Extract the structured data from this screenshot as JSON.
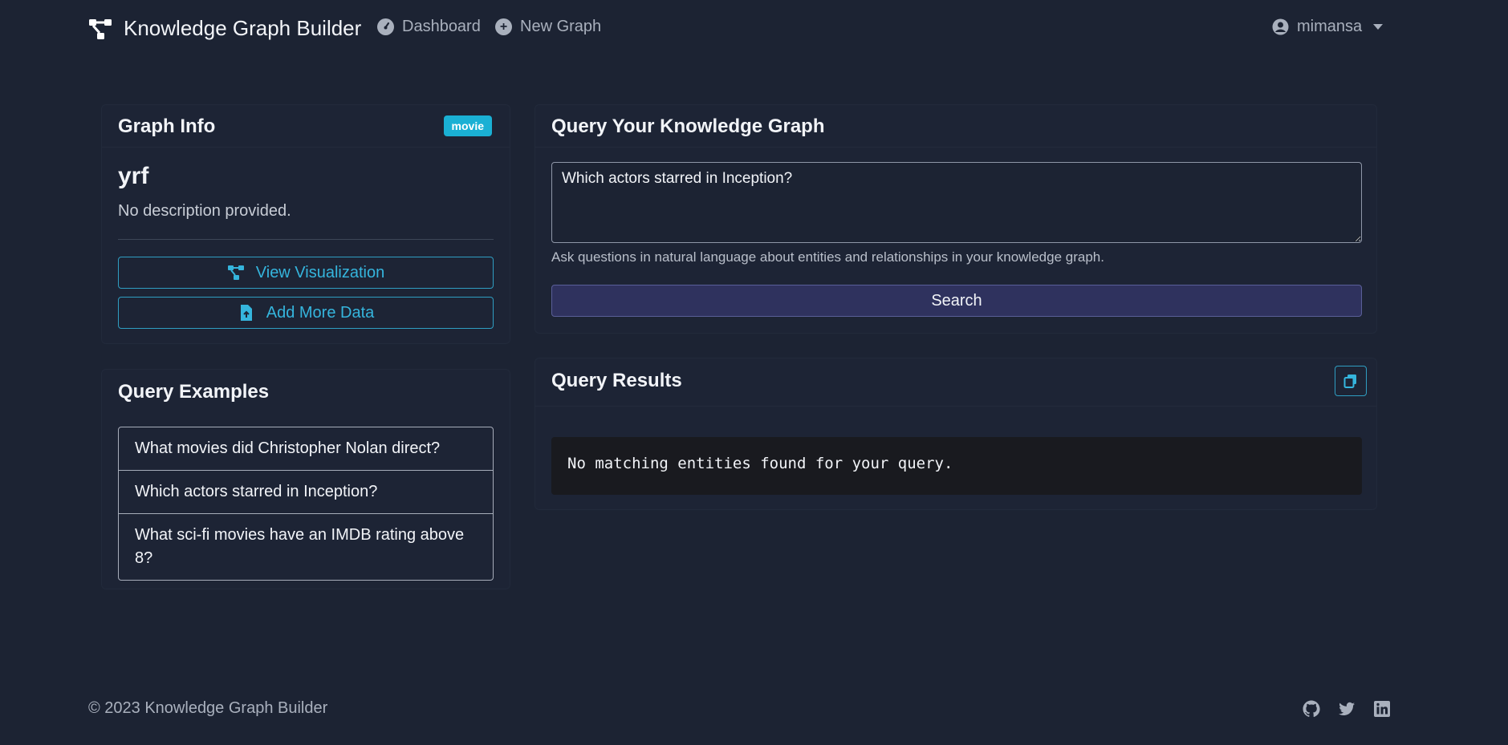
{
  "navbar": {
    "brand": "Knowledge Graph Builder",
    "links": [
      {
        "label": "Dashboard",
        "icon": "dashboard-icon"
      },
      {
        "label": "New Graph",
        "icon": "plus-circle-icon"
      }
    ],
    "user": {
      "name": "mimansa",
      "icon": "user-circle-icon"
    }
  },
  "graph_info": {
    "title": "Graph Info",
    "badge": "movie",
    "name": "yrf",
    "description": "No description provided.",
    "buttons": {
      "view_visualization": "View Visualization",
      "add_more_data": "Add More Data"
    }
  },
  "query_examples": {
    "title": "Query Examples",
    "items": [
      "What movies did Christopher Nolan direct?",
      "Which actors starred in Inception?",
      "What sci-fi movies have an IMDB rating above 8?"
    ]
  },
  "query": {
    "title": "Query Your Knowledge Graph",
    "value": "Which actors starred in Inception?",
    "help": "Ask questions in natural language about entities and relationships in your knowledge graph.",
    "search_label": "Search"
  },
  "results": {
    "title": "Query Results",
    "message": "No matching entities found for your query."
  },
  "footer": {
    "copyright": "© 2023 Knowledge Graph Builder",
    "social": [
      "github-icon",
      "twitter-icon",
      "linkedin-icon"
    ]
  },
  "colors": {
    "background": "#1c2333",
    "accent": "#35b5dd",
    "badge": "#1ab0d4",
    "search_button": "#2f325e"
  }
}
